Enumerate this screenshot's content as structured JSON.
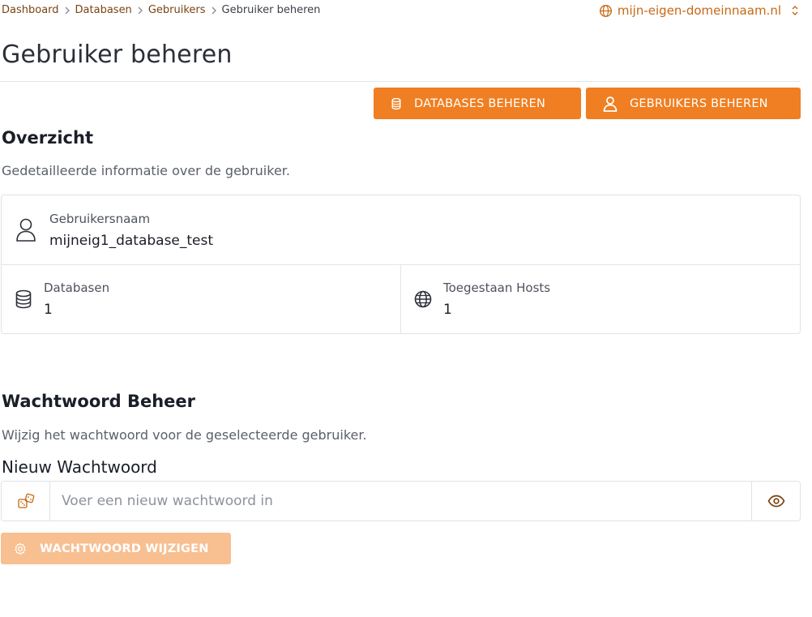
{
  "breadcrumb": {
    "items": [
      "Dashboard",
      "Databasen",
      "Gebruikers"
    ],
    "current": "Gebruiker beheren"
  },
  "domain_selector": {
    "value": "mijn-eigen-domeinnaam.nl",
    "icon": "globe-icon"
  },
  "page_title": "Gebruiker beheren",
  "actions": {
    "databases_label": "DATABASES BEHEREN",
    "users_label": "GEBRUIKERS BEHEREN"
  },
  "overview": {
    "title": "Overzicht",
    "subtitle": "Gedetailleerde informatie over de gebruiker.",
    "username_label": "Gebruikersnaam",
    "username_value": "mijneig1_database_test",
    "databases_label": "Databasen",
    "databases_value": "1",
    "hosts_label": "Toegestaan Hosts",
    "hosts_value": "1"
  },
  "password": {
    "title": "Wachtwoord Beheer",
    "subtitle": "Wijzig het wachtwoord voor de geselecteerde gebruiker.",
    "field_label": "Nieuw Wachtwoord",
    "placeholder": "Voer een nieuw wachtwoord in",
    "value": "",
    "submit_label": "WACHTWOORD WIJZIGEN",
    "submit_disabled": true
  },
  "colors": {
    "accent": "#ef7f22",
    "accent_disabled": "#f8bf91",
    "link_brown": "#7a4412"
  }
}
